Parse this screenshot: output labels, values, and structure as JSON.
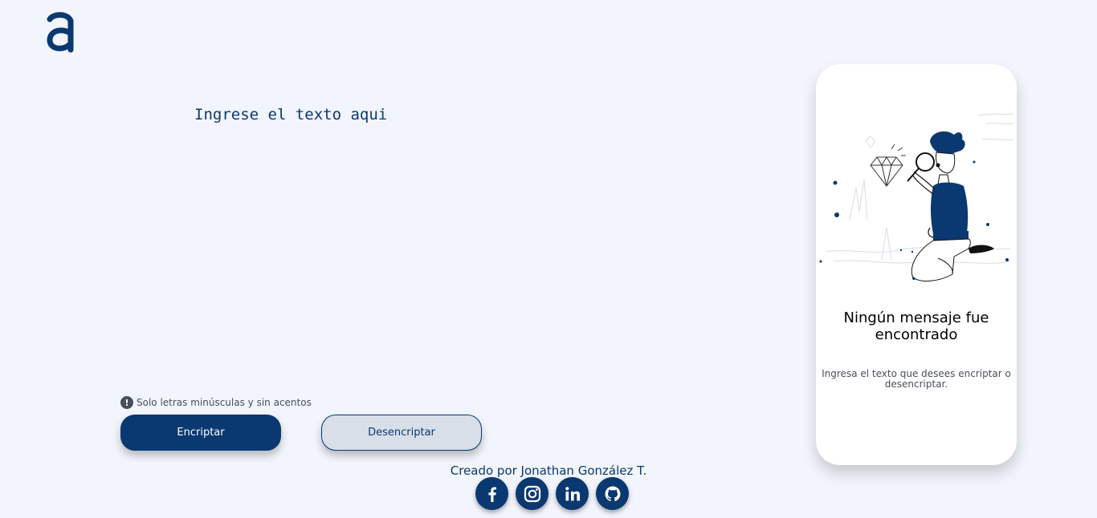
{
  "header": {
    "logo_icon": "alura-a-logo-icon"
  },
  "input": {
    "placeholder": "Ingrese el texto aqui",
    "value": ""
  },
  "hint": {
    "icon": "exclamation-circle-icon",
    "text": "Solo letras minúsculas y sin acentos"
  },
  "buttons": {
    "encrypt_label": "Encriptar",
    "decrypt_label": "Desencriptar"
  },
  "output": {
    "illustration": "person-with-magnifying-glass-illustration",
    "title": "Ningún mensaje fue encontrado",
    "subtitle": "Ingresa el texto que desees encriptar o desencriptar."
  },
  "footer": {
    "credit": "Creado por Jonathan González T.",
    "socials": [
      {
        "name": "facebook-icon"
      },
      {
        "name": "instagram-icon"
      },
      {
        "name": "linkedin-icon"
      },
      {
        "name": "github-icon"
      }
    ]
  },
  "colors": {
    "background": "#f2f5fc",
    "primary": "#0a3871",
    "secondary_button": "#d8dfe8",
    "muted_text": "#495057"
  }
}
